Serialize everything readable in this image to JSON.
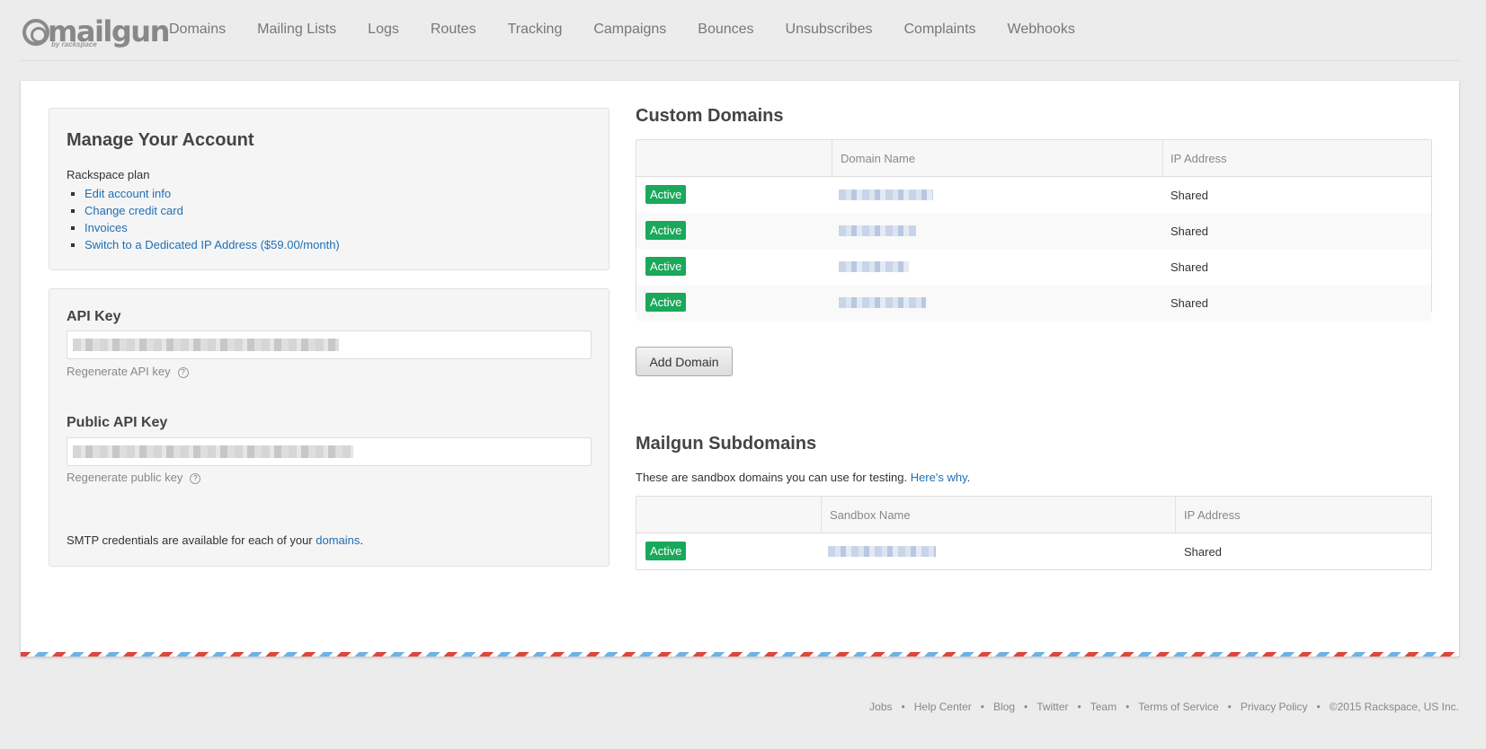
{
  "logo": {
    "word": "mailgun",
    "by": "by rackspace"
  },
  "nav": [
    "Domains",
    "Mailing Lists",
    "Logs",
    "Routes",
    "Tracking",
    "Campaigns",
    "Bounces",
    "Unsubscribes",
    "Complaints",
    "Webhooks"
  ],
  "account": {
    "title": "Manage Your Account",
    "plan": "Rackspace plan",
    "links": [
      "Edit account info",
      "Change credit card",
      "Invoices",
      "Switch to a Dedicated IP Address ($59.00/month)"
    ]
  },
  "api": {
    "api_key_title": "API Key",
    "regen_api": "Regenerate API key",
    "public_key_title": "Public API Key",
    "regen_public": "Regenerate public key",
    "help_glyph": "?",
    "smtp_text": "SMTP credentials are available for each of your ",
    "smtp_link": "domains",
    "smtp_end": "."
  },
  "custom_domains": {
    "title": "Custom Domains",
    "headers": [
      "Domain Name",
      "IP Address"
    ],
    "rows": [
      {
        "status": "Active",
        "ip": "Shared"
      },
      {
        "status": "Active",
        "ip": "Shared"
      },
      {
        "status": "Active",
        "ip": "Shared"
      },
      {
        "status": "Active",
        "ip": "Shared"
      }
    ],
    "add_button": "Add Domain"
  },
  "subdomains": {
    "title": "Mailgun Subdomains",
    "note": "These are sandbox domains you can use for testing. ",
    "note_link": "Here's why",
    "note_end": ".",
    "headers": [
      "Sandbox Name",
      "IP Address"
    ],
    "rows": [
      {
        "status": "Active",
        "ip": "Shared"
      }
    ]
  },
  "footer": [
    "Jobs",
    "Help Center",
    "Blog",
    "Twitter",
    "Team",
    "Terms of Service",
    "Privacy Policy",
    "©2015 Rackspace, US Inc."
  ],
  "colors": {
    "active_badge": "#1aa85a",
    "link": "#1f6fb5"
  }
}
